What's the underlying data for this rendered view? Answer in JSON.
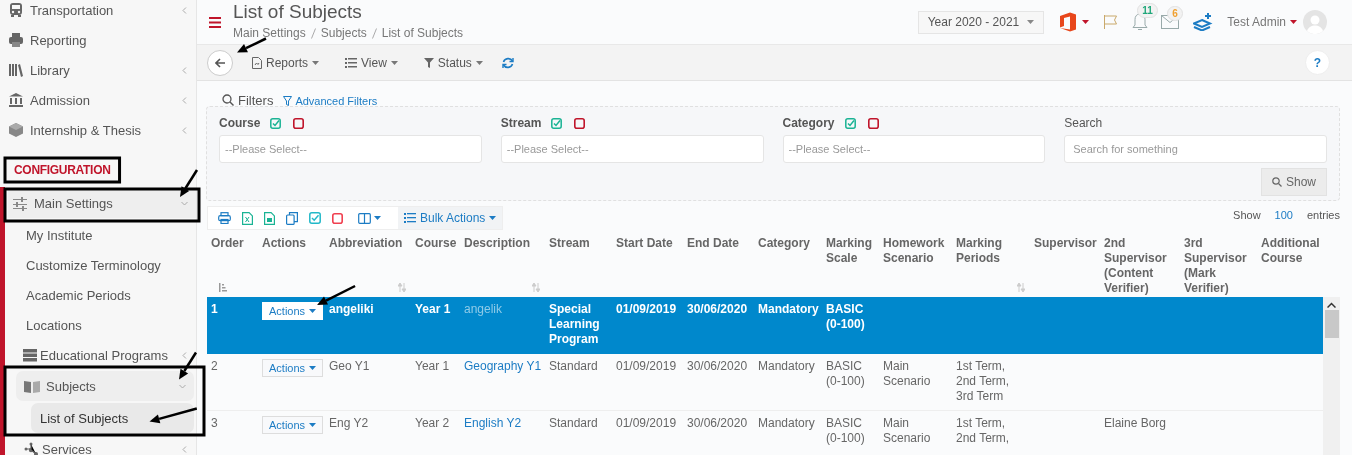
{
  "sidebar": {
    "items": [
      {
        "kind": "group",
        "label": "Transportation",
        "expanded": false,
        "selected": false
      },
      {
        "kind": "link",
        "label": "Reporting",
        "selected": false
      },
      {
        "kind": "group",
        "label": "Library",
        "expanded": false,
        "selected": false
      },
      {
        "kind": "group",
        "label": "Admission",
        "expanded": false,
        "selected": false
      },
      {
        "kind": "group",
        "label": "Internship & Thesis",
        "expanded": false,
        "selected": false
      },
      {
        "kind": "section",
        "label": "CONFIGURATION"
      },
      {
        "kind": "group",
        "label": "Main Settings",
        "expanded": true,
        "selected": false,
        "children": [
          {
            "kind": "link",
            "label": "My Institute",
            "selected": false
          },
          {
            "kind": "link",
            "label": "Customize Terminology",
            "selected": false
          },
          {
            "kind": "link",
            "label": "Academic Periods",
            "selected": false
          },
          {
            "kind": "link",
            "label": "Locations",
            "selected": false
          },
          {
            "kind": "group",
            "label": "Educational Programs",
            "expanded": false,
            "selected": false
          },
          {
            "kind": "group",
            "label": "Subjects",
            "expanded": true,
            "selected": false,
            "children": [
              {
                "kind": "link",
                "label": "List of Subjects",
                "selected": true
              }
            ]
          },
          {
            "kind": "group",
            "label": "Services",
            "expanded": false,
            "selected": false
          }
        ]
      }
    ]
  },
  "header": {
    "title": "List of Subjects",
    "breadcrumb": [
      "Main Settings",
      "Subjects",
      "List of Subjects"
    ],
    "year": "Year 2020 - 2021",
    "notifications": [
      {
        "kind": "bell",
        "count": "11"
      },
      {
        "kind": "mail",
        "count": "6"
      }
    ],
    "user": "Test Admin"
  },
  "toolbar": {
    "menus": [
      "Reports",
      "View",
      "Status"
    ],
    "help": "?"
  },
  "filters": {
    "title": "Filters",
    "advanced_link": "Advanced Filters",
    "fields": [
      {
        "label": "Course",
        "placeholder": "--Please Select--"
      },
      {
        "label": "Stream",
        "placeholder": "--Please Select--"
      },
      {
        "label": "Category",
        "placeholder": "--Please Select--"
      }
    ],
    "search": {
      "label": "Search",
      "placeholder": "Search for something"
    },
    "show_button": "Show"
  },
  "table_toolbar": {
    "bulk_actions": "Bulk Actions",
    "show_label": "Show",
    "page_size": "100",
    "entries_label": "entries"
  },
  "table": {
    "columns": [
      {
        "label": "Order",
        "sortable": true,
        "sorted": true
      },
      {
        "label": "Actions",
        "sortable": false,
        "sorted": false
      },
      {
        "label": "Abbreviation",
        "sortable": true,
        "sorted": false
      },
      {
        "label": "Course",
        "sortable": false,
        "sorted": false
      },
      {
        "label": "Description",
        "sortable": true,
        "sorted": false
      },
      {
        "label": "Stream",
        "sortable": false,
        "sorted": false
      },
      {
        "label": "Start Date",
        "sortable": false,
        "sorted": false
      },
      {
        "label": "End Date",
        "sortable": false,
        "sorted": false
      },
      {
        "label": "Category",
        "sortable": false,
        "sorted": false
      },
      {
        "label": "Marking Scale",
        "sortable": false,
        "sorted": false
      },
      {
        "label": "Homework Scenario",
        "sortable": false,
        "sorted": false
      },
      {
        "label": "Marking Periods",
        "sortable": true,
        "sorted": false
      },
      {
        "label": "Supervisor",
        "sortable": false,
        "sorted": false
      },
      {
        "label": "2nd Supervisor (Content Verifier)",
        "sortable": false,
        "sorted": false
      },
      {
        "label": "3rd Supervisor (Mark Verifier)",
        "sortable": false,
        "sorted": false
      },
      {
        "label": "Additional Course",
        "sortable": false,
        "sorted": false
      }
    ],
    "rows": [
      {
        "selected": true,
        "order": "1",
        "action": "Actions",
        "abbreviation": "angeliki",
        "course": "Year 1",
        "description": "angelik",
        "stream": "Special Learning Program",
        "start_date": "01/09/2019",
        "end_date": "30/06/2020",
        "category": "Mandatory",
        "marking_scale": "BASIC (0-100)"
      },
      {
        "selected": false,
        "order": "2",
        "action": "Actions",
        "abbreviation": "Geo Y1",
        "course": "Year 1",
        "description": "Geography Y1",
        "stream": "Standard",
        "start_date": "01/09/2019",
        "end_date": "30/06/2020",
        "category": "Mandatory",
        "marking_scale": "BASIC (0-100)",
        "homework_scenario": "Main Scenario",
        "marking_periods": "1st Term, 2nd Term, 3rd Term"
      },
      {
        "selected": false,
        "order": "3",
        "action": "Actions",
        "abbreviation": "Eng Y2",
        "course": "Year 2",
        "description": "English Y2",
        "stream": "Standard",
        "start_date": "01/09/2019",
        "end_date": "30/06/2020",
        "category": "Mandatory",
        "marking_scale": "BASIC (0-100)",
        "homework_scenario": "Main Scenario",
        "marking_periods": "1st Term, 2nd Term,",
        "second_supervisor": "Elaine Borg"
      }
    ]
  }
}
